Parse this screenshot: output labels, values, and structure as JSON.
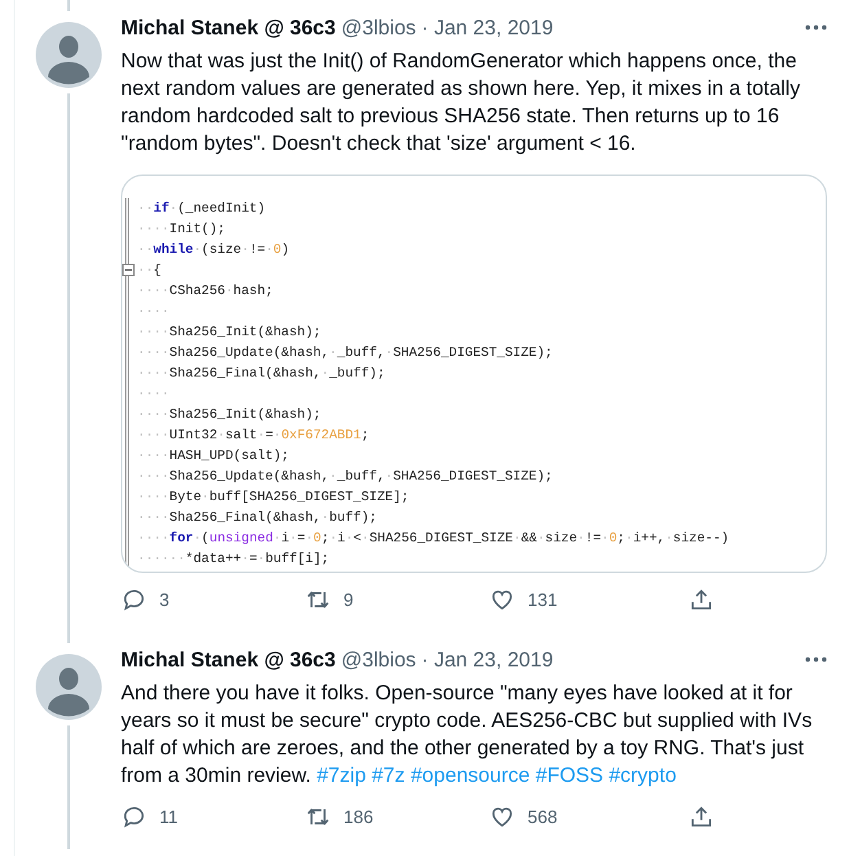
{
  "tweets": [
    {
      "author": "Michal Stanek @ 36c3",
      "handle": "@3lbios",
      "date": "· Jan 23, 2019",
      "text": "Now that was just the Init() of RandomGenerator which happens once, the next random values are generated as shown here. Yep, it mixes in a totally random hardcoded salt to previous SHA256 state. Then returns up to 16 \"random bytes\". Doesn't check that 'size' argument < 16.",
      "code_lines": [
        {
          "fold_marker": false,
          "tokens": [
            {
              "kind": "ws",
              "text": "··"
            },
            {
              "kind": "keyword",
              "text": "if"
            },
            {
              "kind": "ws",
              "text": "·"
            },
            {
              "kind": "plain",
              "text": "(_needInit)"
            }
          ]
        },
        {
          "fold_marker": false,
          "tokens": [
            {
              "kind": "ws",
              "text": "····"
            },
            {
              "kind": "plain",
              "text": "Init();"
            }
          ]
        },
        {
          "fold_marker": false,
          "tokens": [
            {
              "kind": "ws",
              "text": "··"
            },
            {
              "kind": "keyword",
              "text": "while"
            },
            {
              "kind": "ws",
              "text": "·"
            },
            {
              "kind": "plain",
              "text": "(size"
            },
            {
              "kind": "ws",
              "text": "·"
            },
            {
              "kind": "plain",
              "text": "!="
            },
            {
              "kind": "ws",
              "text": "·"
            },
            {
              "kind": "number",
              "text": "0"
            },
            {
              "kind": "plain",
              "text": ")"
            }
          ]
        },
        {
          "fold_marker": true,
          "tokens": [
            {
              "kind": "ws",
              "text": "··"
            },
            {
              "kind": "plain",
              "text": "{"
            }
          ]
        },
        {
          "fold_marker": false,
          "tokens": [
            {
              "kind": "ws",
              "text": "····"
            },
            {
              "kind": "plain",
              "text": "CSha256"
            },
            {
              "kind": "ws",
              "text": "·"
            },
            {
              "kind": "plain",
              "text": "hash;"
            }
          ]
        },
        {
          "fold_marker": false,
          "tokens": [
            {
              "kind": "ws",
              "text": "····"
            }
          ]
        },
        {
          "fold_marker": false,
          "tokens": [
            {
              "kind": "ws",
              "text": "····"
            },
            {
              "kind": "plain",
              "text": "Sha256_Init(&hash);"
            }
          ]
        },
        {
          "fold_marker": false,
          "tokens": [
            {
              "kind": "ws",
              "text": "····"
            },
            {
              "kind": "plain",
              "text": "Sha256_Update(&hash,"
            },
            {
              "kind": "ws",
              "text": "·"
            },
            {
              "kind": "plain",
              "text": "_buff,"
            },
            {
              "kind": "ws",
              "text": "·"
            },
            {
              "kind": "plain",
              "text": "SHA256_DIGEST_SIZE);"
            }
          ]
        },
        {
          "fold_marker": false,
          "tokens": [
            {
              "kind": "ws",
              "text": "····"
            },
            {
              "kind": "plain",
              "text": "Sha256_Final(&hash,"
            },
            {
              "kind": "ws",
              "text": "·"
            },
            {
              "kind": "plain",
              "text": "_buff);"
            }
          ]
        },
        {
          "fold_marker": false,
          "tokens": [
            {
              "kind": "ws",
              "text": "····"
            }
          ]
        },
        {
          "fold_marker": false,
          "tokens": [
            {
              "kind": "ws",
              "text": "····"
            },
            {
              "kind": "plain",
              "text": "Sha256_Init(&hash);"
            }
          ]
        },
        {
          "fold_marker": false,
          "tokens": [
            {
              "kind": "ws",
              "text": "····"
            },
            {
              "kind": "plain",
              "text": "UInt32"
            },
            {
              "kind": "ws",
              "text": "·"
            },
            {
              "kind": "plain",
              "text": "salt"
            },
            {
              "kind": "ws",
              "text": "·"
            },
            {
              "kind": "plain",
              "text": "="
            },
            {
              "kind": "ws",
              "text": "·"
            },
            {
              "kind": "number",
              "text": "0xF672ABD1"
            },
            {
              "kind": "plain",
              "text": ";"
            }
          ]
        },
        {
          "fold_marker": false,
          "tokens": [
            {
              "kind": "ws",
              "text": "····"
            },
            {
              "kind": "plain",
              "text": "HASH_UPD(salt);"
            }
          ]
        },
        {
          "fold_marker": false,
          "tokens": [
            {
              "kind": "ws",
              "text": "····"
            },
            {
              "kind": "plain",
              "text": "Sha256_Update(&hash,"
            },
            {
              "kind": "ws",
              "text": "·"
            },
            {
              "kind": "plain",
              "text": "_buff,"
            },
            {
              "kind": "ws",
              "text": "·"
            },
            {
              "kind": "plain",
              "text": "SHA256_DIGEST_SIZE);"
            }
          ]
        },
        {
          "fold_marker": false,
          "tokens": [
            {
              "kind": "ws",
              "text": "····"
            },
            {
              "kind": "plain",
              "text": "Byte"
            },
            {
              "kind": "ws",
              "text": "·"
            },
            {
              "kind": "plain",
              "text": "buff[SHA256_DIGEST_SIZE];"
            }
          ]
        },
        {
          "fold_marker": false,
          "tokens": [
            {
              "kind": "ws",
              "text": "····"
            },
            {
              "kind": "plain",
              "text": "Sha256_Final(&hash,"
            },
            {
              "kind": "ws",
              "text": "·"
            },
            {
              "kind": "plain",
              "text": "buff);"
            }
          ]
        },
        {
          "fold_marker": false,
          "tokens": [
            {
              "kind": "ws",
              "text": "····"
            },
            {
              "kind": "keyword",
              "text": "for"
            },
            {
              "kind": "ws",
              "text": "·"
            },
            {
              "kind": "plain",
              "text": "("
            },
            {
              "kind": "type",
              "text": "unsigned"
            },
            {
              "kind": "ws",
              "text": "·"
            },
            {
              "kind": "plain",
              "text": "i"
            },
            {
              "kind": "ws",
              "text": "·"
            },
            {
              "kind": "plain",
              "text": "="
            },
            {
              "kind": "ws",
              "text": "·"
            },
            {
              "kind": "number",
              "text": "0"
            },
            {
              "kind": "plain",
              "text": ";"
            },
            {
              "kind": "ws",
              "text": "·"
            },
            {
              "kind": "plain",
              "text": "i"
            },
            {
              "kind": "ws",
              "text": "·"
            },
            {
              "kind": "plain",
              "text": "<"
            },
            {
              "kind": "ws",
              "text": "·"
            },
            {
              "kind": "plain",
              "text": "SHA256_DIGEST_SIZE"
            },
            {
              "kind": "ws",
              "text": "·"
            },
            {
              "kind": "plain",
              "text": "&&"
            },
            {
              "kind": "ws",
              "text": "·"
            },
            {
              "kind": "plain",
              "text": "size"
            },
            {
              "kind": "ws",
              "text": "·"
            },
            {
              "kind": "plain",
              "text": "!="
            },
            {
              "kind": "ws",
              "text": "·"
            },
            {
              "kind": "number",
              "text": "0"
            },
            {
              "kind": "plain",
              "text": ";"
            },
            {
              "kind": "ws",
              "text": "·"
            },
            {
              "kind": "plain",
              "text": "i++,"
            },
            {
              "kind": "ws",
              "text": "·"
            },
            {
              "kind": "plain",
              "text": "size--)"
            }
          ]
        },
        {
          "fold_marker": false,
          "tokens": [
            {
              "kind": "ws",
              "text": "····"
            },
            {
              "kind": "ws",
              "text": "··"
            },
            {
              "kind": "plain",
              "text": "*data++"
            },
            {
              "kind": "ws",
              "text": "·"
            },
            {
              "kind": "plain",
              "text": "="
            },
            {
              "kind": "ws",
              "text": "·"
            },
            {
              "kind": "plain",
              "text": "buff[i];"
            }
          ]
        }
      ],
      "replies": "3",
      "retweets": "9",
      "likes": "131"
    },
    {
      "author": "Michal Stanek @ 36c3",
      "handle": "@3lbios",
      "date": "· Jan 23, 2019",
      "text": "And there you have it folks. Open-source \"many eyes have looked at it for years so it must be secure\" crypto code. AES256-CBC but supplied with IVs half of which are zeroes, and the other generated by a toy RNG. That's just from a 30min review.",
      "hashtags": [
        "#7zip",
        "#7z",
        "#opensource",
        "#FOSS",
        "#crypto"
      ],
      "replies": "11",
      "retweets": "186",
      "likes": "568"
    }
  ]
}
